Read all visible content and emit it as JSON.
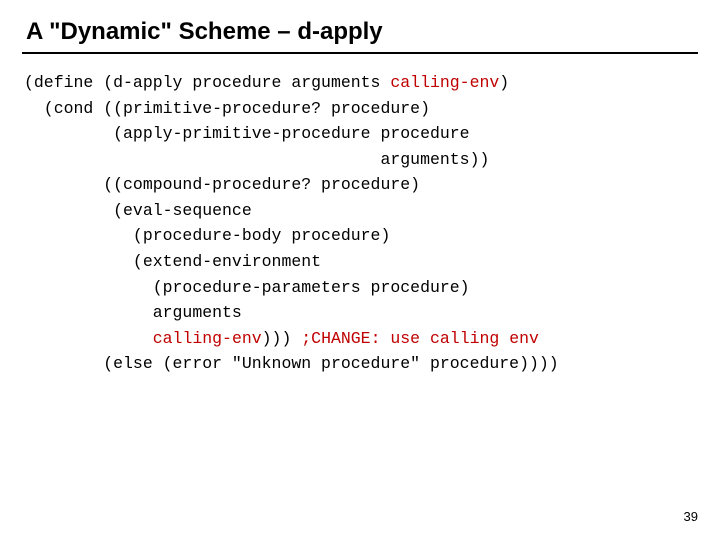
{
  "title": "A \"Dynamic\" Scheme – d-apply",
  "page_number": "39",
  "code": {
    "l1a": "(define (d-apply procedure arguments ",
    "l1b": "calling-env",
    "l1c": ")",
    "l2": "  (cond ((primitive-procedure? procedure)",
    "l3": "         (apply-primitive-procedure procedure",
    "l4": "                                    arguments))",
    "l5": "        ((compound-procedure? procedure)",
    "l6": "         (eval-sequence",
    "l7": "           (procedure-body procedure)",
    "l8": "           (extend-environment",
    "l9": "             (procedure-parameters procedure)",
    "l10": "             arguments",
    "l11a": "             ",
    "l11b": "calling-env",
    "l11c": "))) ",
    "l11d": ";CHANGE: use calling env",
    "l12": "        (else (error \"Unknown procedure\" procedure))))"
  }
}
